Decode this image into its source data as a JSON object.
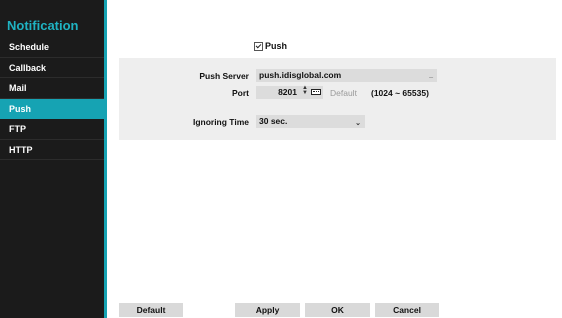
{
  "sidebar": {
    "title": "Notification",
    "items": [
      {
        "label": "Schedule"
      },
      {
        "label": "Callback"
      },
      {
        "label": "Mail"
      },
      {
        "label": "Push",
        "active": true
      },
      {
        "label": "FTP"
      },
      {
        "label": "HTTP"
      }
    ]
  },
  "push": {
    "label": "Push",
    "checked": true
  },
  "settings": {
    "push_server": {
      "label": "Push Server",
      "value": "push.idisglobal.com"
    },
    "port": {
      "label": "Port",
      "value": "8201",
      "default_label": "Default",
      "range": "(1024 ~ 65535)"
    },
    "ignoring_time": {
      "label": "Ignoring Time",
      "value": "30 sec."
    }
  },
  "buttons": {
    "default": "Default",
    "apply": "Apply",
    "ok": "OK",
    "cancel": "Cancel"
  },
  "colors": {
    "accent": "#16a3b3",
    "sidebar_bg": "#1b1b1b",
    "panel_bg": "#eeeeee"
  }
}
